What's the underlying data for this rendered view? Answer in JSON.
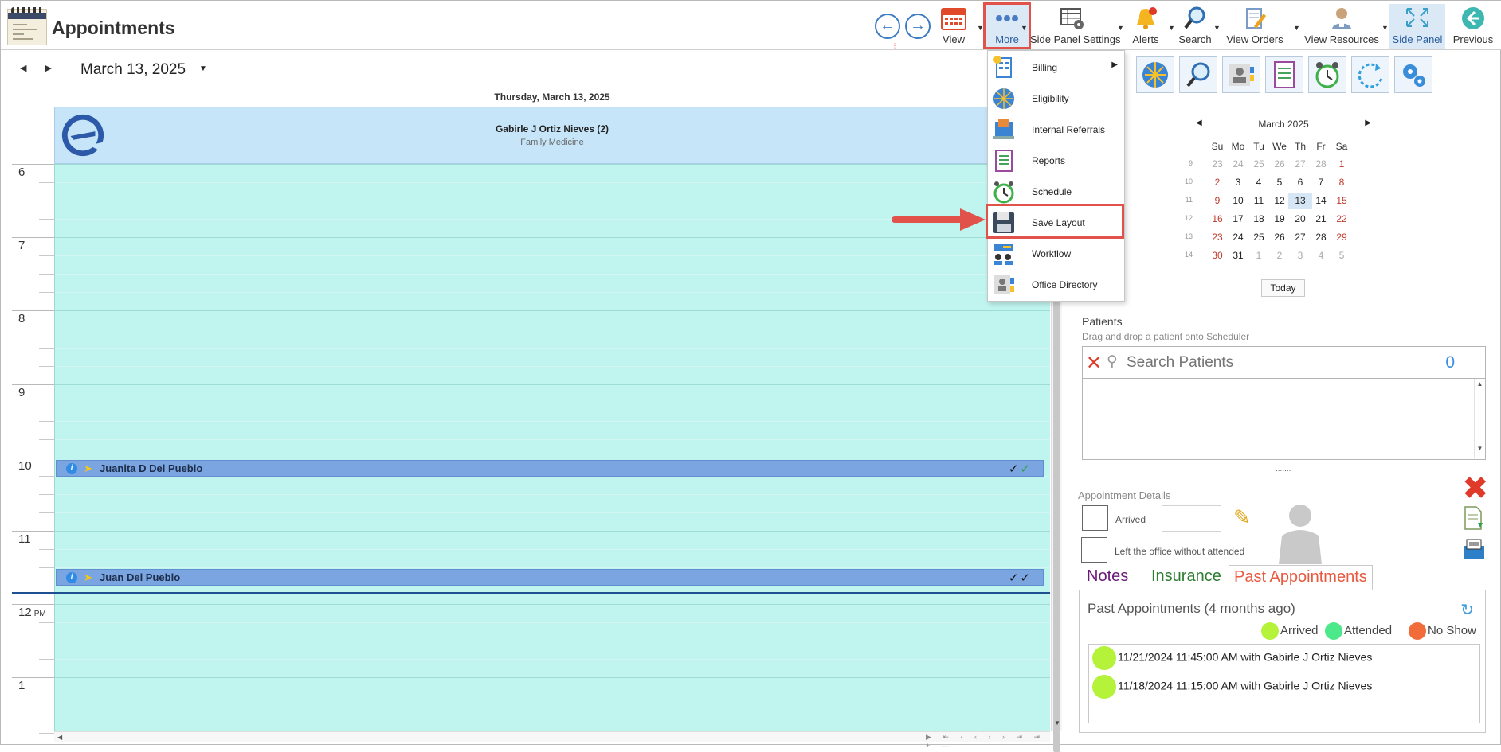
{
  "app": {
    "title": "Appointments"
  },
  "toolbar": {
    "view": "View",
    "more": "More",
    "side_panel_settings": "Side Panel Settings",
    "alerts": "Alerts",
    "search": "Search",
    "view_orders": "View Orders",
    "view_resources": "View Resources",
    "side_panel": "Side Panel",
    "previous": "Previous"
  },
  "scheduler": {
    "date": "March 13, 2025",
    "day_header": "Thursday, March 13, 2025",
    "resource_name": "Gabirle J Ortiz Nieves (2)",
    "resource_specialty": "Family Medicine",
    "hours": [
      "6",
      "7",
      "8",
      "9",
      "10",
      "11",
      "12",
      "1"
    ],
    "pm_label": "PM",
    "appointments": [
      {
        "name": "Juanita D Del Pueblo"
      },
      {
        "name": "Juan Del Pueblo"
      }
    ]
  },
  "more_menu": {
    "items": [
      {
        "label": "Billing",
        "icon": "billing-icon",
        "submenu": true
      },
      {
        "label": "Eligibility",
        "icon": "eligibility-icon"
      },
      {
        "label": "Internal Referrals",
        "icon": "internal-referrals-icon"
      },
      {
        "label": "Reports",
        "icon": "reports-icon"
      },
      {
        "label": "Schedule",
        "icon": "schedule-icon"
      },
      {
        "label": "Save Layout",
        "icon": "save-layout-icon",
        "highlighted": true
      },
      {
        "label": "Workflow",
        "icon": "workflow-icon"
      },
      {
        "label": "Office Directory",
        "icon": "office-directory-icon"
      }
    ]
  },
  "mini_calendar": {
    "title": "March 2025",
    "dow": [
      "Su",
      "Mo",
      "Tu",
      "We",
      "Th",
      "Fr",
      "Sa"
    ],
    "weeks": [
      {
        "wk": "9",
        "days": [
          "23",
          "24",
          "25",
          "26",
          "27",
          "28",
          "1"
        ]
      },
      {
        "wk": "10",
        "days": [
          "2",
          "3",
          "4",
          "5",
          "6",
          "7",
          "8"
        ]
      },
      {
        "wk": "11",
        "days": [
          "9",
          "10",
          "11",
          "12",
          "13",
          "14",
          "15"
        ]
      },
      {
        "wk": "12",
        "days": [
          "16",
          "17",
          "18",
          "19",
          "20",
          "21",
          "22"
        ]
      },
      {
        "wk": "13",
        "days": [
          "23",
          "24",
          "25",
          "26",
          "27",
          "28",
          "29"
        ]
      },
      {
        "wk": "14",
        "days": [
          "30",
          "31",
          "1",
          "2",
          "3",
          "4",
          "5"
        ]
      }
    ],
    "selected": "13",
    "today_label": "Today"
  },
  "patients": {
    "title": "Patients",
    "subtitle": "Drag and drop a patient onto Scheduler",
    "search_placeholder": "Search Patients",
    "count": "0"
  },
  "appointment_details": {
    "title": "Appointment Details",
    "arrived_label": "Arrived",
    "left_label": "Left the office without attended"
  },
  "tabs": {
    "notes": "Notes",
    "insurance": "Insurance",
    "past": "Past Appointments"
  },
  "past_appointments": {
    "title": "Past Appointments (4 months ago)",
    "legend": [
      {
        "label": "Arrived",
        "color": "#b5f23a"
      },
      {
        "label": "Attended",
        "color": "#4de88a"
      },
      {
        "label": "No Show",
        "color": "#f26b3a"
      }
    ],
    "rows": [
      "11/21/2024 11:45:00 AM with Gabirle J Ortiz Nieves",
      "11/18/2024 11:15:00 AM with Gabirle J Ortiz Nieves"
    ]
  },
  "colors": {
    "accent_red": "#e0524a",
    "grid_fill": "#c0f5ef",
    "appt_fill": "#7aa5e0",
    "resource_header": "#c6e5f8"
  }
}
